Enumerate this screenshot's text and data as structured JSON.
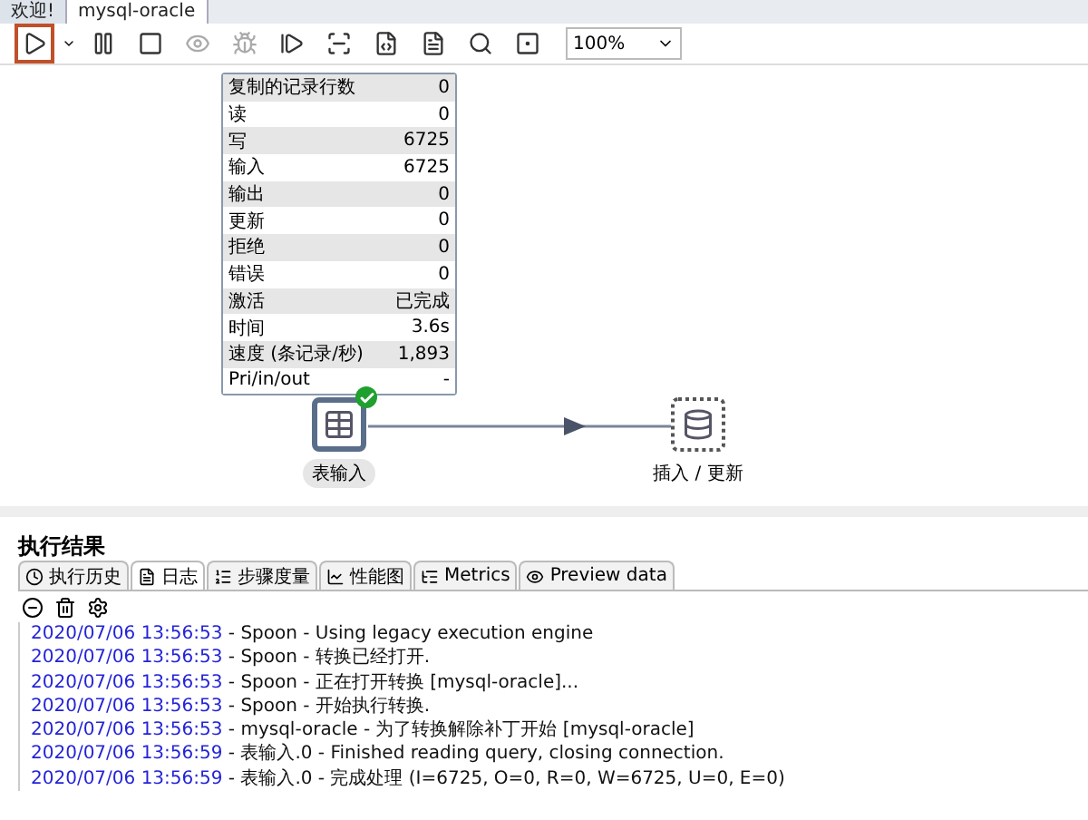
{
  "editor_tabs": [
    {
      "label": "欢迎!",
      "selected": false
    },
    {
      "label": "mysql-oracle",
      "selected": true
    }
  ],
  "toolbar": {
    "buttons": [
      {
        "selected": true,
        "disabled": false
      },
      {
        "selected": false,
        "disabled": false
      },
      {
        "selected": false,
        "disabled": false
      },
      {
        "selected": false,
        "disabled": true
      },
      {
        "selected": false,
        "disabled": true
      },
      {
        "selected": false,
        "disabled": false
      },
      {
        "selected": false,
        "disabled": false
      },
      {
        "selected": false,
        "disabled": false
      },
      {
        "selected": false,
        "disabled": false
      },
      {
        "selected": false,
        "disabled": false
      },
      {
        "selected": false,
        "disabled": false
      }
    ],
    "zoom": "100%"
  },
  "stats": [
    {
      "label": "复制的记录行数",
      "value": "0"
    },
    {
      "label": "读",
      "value": "0"
    },
    {
      "label": "写",
      "value": "6725"
    },
    {
      "label": "输入",
      "value": "6725"
    },
    {
      "label": "输出",
      "value": "0"
    },
    {
      "label": "更新",
      "value": "0"
    },
    {
      "label": "拒绝",
      "value": "0"
    },
    {
      "label": "错误",
      "value": "0"
    },
    {
      "label": "激活",
      "value": "已完成"
    },
    {
      "label": "时间",
      "value": "3.6s"
    },
    {
      "label": "速度 (条记录/秒)",
      "value": "1,893"
    },
    {
      "label": "Pri/in/out",
      "value": "-"
    }
  ],
  "steps": [
    {
      "label": "表输入",
      "kind": "table",
      "selected": true,
      "done": true
    },
    {
      "label": "插入 / 更新",
      "kind": "db",
      "selected": false,
      "done": false
    }
  ],
  "results": {
    "title": "执行结果",
    "tabs": [
      {
        "label": "执行历史",
        "selected": false
      },
      {
        "label": "日志",
        "selected": true
      },
      {
        "label": "步骤度量",
        "selected": false
      },
      {
        "label": "性能图",
        "selected": false
      },
      {
        "label": "Metrics",
        "selected": false
      },
      {
        "label": "Preview data",
        "selected": false
      }
    ],
    "log": [
      {
        "time": "2020/07/06 13:56:53",
        "message": " - Spoon - Using legacy execution engine"
      },
      {
        "time": "2020/07/06 13:56:53",
        "message": " - Spoon - 转换已经打开."
      },
      {
        "time": "2020/07/06 13:56:53",
        "message": " - Spoon - 正在打开转换 [mysql-oracle]..."
      },
      {
        "time": "2020/07/06 13:56:53",
        "message": " - Spoon - 开始执行转换."
      },
      {
        "time": "2020/07/06 13:56:53",
        "message": " - mysql-oracle - 为了转换解除补丁开始  [mysql-oracle]"
      },
      {
        "time": "2020/07/06 13:56:59",
        "message": " - 表输入.0 - Finished reading query, closing connection."
      },
      {
        "time": "2020/07/06 13:56:59",
        "message": " - 表输入.0 - 完成处理 (I=6725, O=0, R=0, W=6725, U=0, E=0)"
      }
    ]
  }
}
